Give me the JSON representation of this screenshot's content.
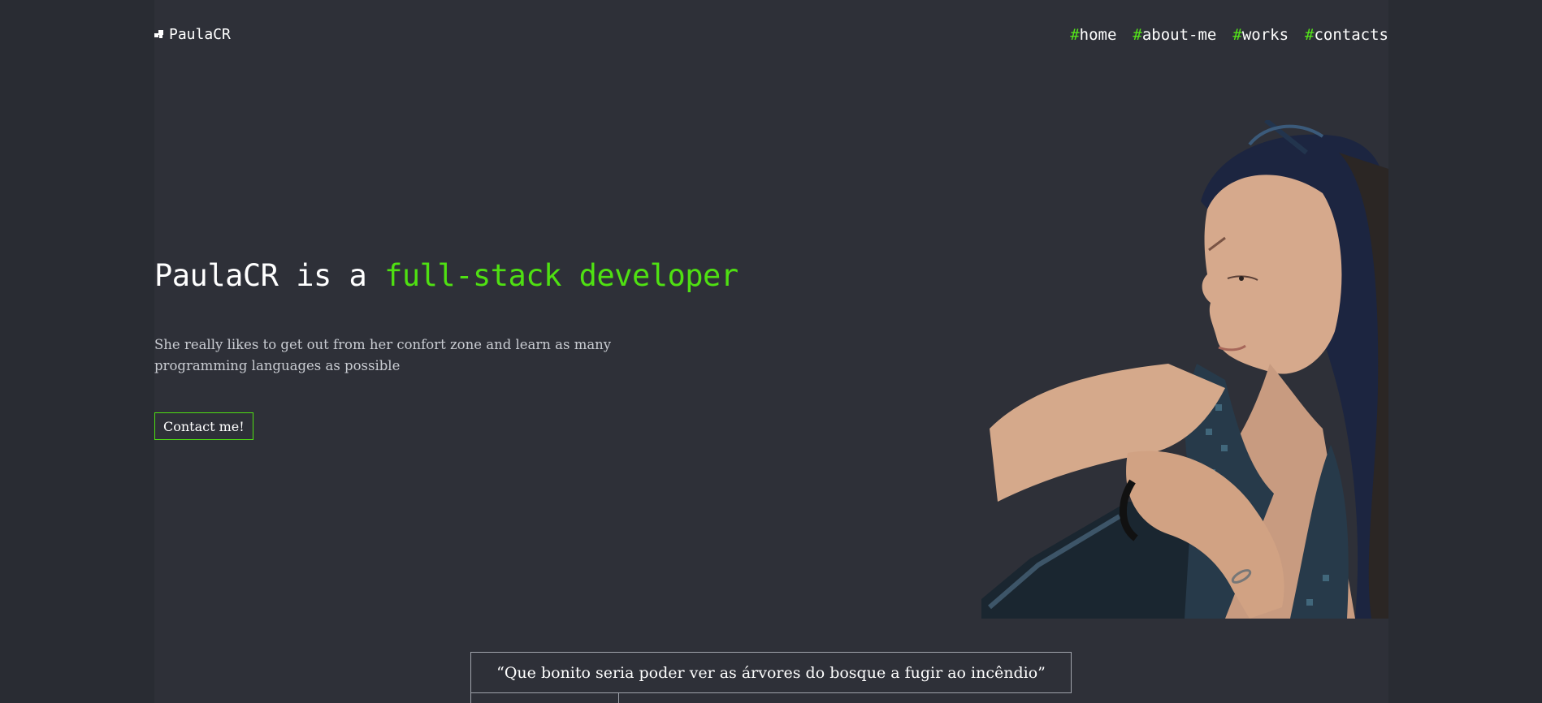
{
  "header": {
    "logo_text": "PaulaCR",
    "logo_icon": "logo-squares-icon",
    "nav": [
      {
        "hash": "#",
        "label": "home"
      },
      {
        "hash": "#",
        "label": "about-me"
      },
      {
        "hash": "#",
        "label": "works"
      },
      {
        "hash": "#",
        "label": "contacts"
      }
    ]
  },
  "hero": {
    "headline_prefix": "PaulaCR is a ",
    "headline_accent": "full-stack developer",
    "description": "She really likes to get out from her confort zone and learn as many programming languages as possible",
    "cta_label": "Contact me!",
    "portrait": "portrait-photo-of-woman"
  },
  "quote": {
    "text": "“Que bonito seria poder ver as árvores do bosque a fugir ao incêndio”"
  },
  "colors": {
    "background": "#2e3038",
    "accent": "#4fe012",
    "text": "#ffffff",
    "muted_text": "#c9ccd2",
    "border": "#a0a3ab"
  }
}
